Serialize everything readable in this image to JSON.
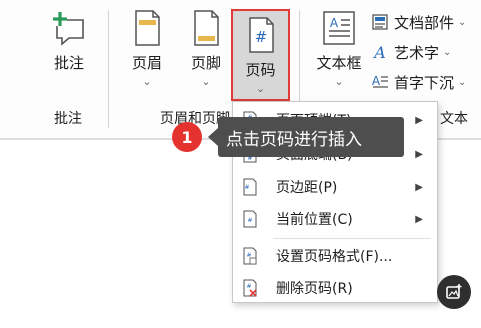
{
  "ribbon": {
    "buttons": {
      "pizhu": {
        "label": "批注",
        "icon": "add-comment-icon"
      },
      "yemei": {
        "label": "页眉",
        "icon": "header-icon"
      },
      "yejiao": {
        "label": "页脚",
        "icon": "footer-icon"
      },
      "yema": {
        "label": "页码",
        "icon": "page-number-icon"
      },
      "wenbenkuang": {
        "label": "文本框",
        "icon": "text-box-icon"
      }
    },
    "small_items": [
      {
        "label": "文档部件",
        "icon": "quick-parts-icon"
      },
      {
        "label": "艺术字",
        "icon": "wordart-icon"
      },
      {
        "label": "首字下沉",
        "icon": "drop-cap-icon"
      }
    ],
    "groups": {
      "comment": "批注",
      "header_footer": "页眉和页脚",
      "text": "文本"
    },
    "chevron": "⌄"
  },
  "page_number_menu": {
    "items": [
      {
        "label": "页面顶端(T)",
        "icon": "page-top-icon",
        "submenu": true
      },
      {
        "label": "页面底端(B)",
        "icon": "page-bottom-icon",
        "submenu": true
      },
      {
        "label": "页边距(P)",
        "icon": "page-margin-icon",
        "submenu": true
      },
      {
        "label": "当前位置(C)",
        "icon": "current-position-icon",
        "submenu": true
      },
      {
        "label": "设置页码格式(F)...",
        "icon": "format-page-number-icon",
        "submenu": false
      },
      {
        "label": "删除页码(R)",
        "icon": "remove-page-number-icon",
        "submenu": false
      }
    ],
    "submenu_arrow": "▶"
  },
  "callout": {
    "number": "1",
    "text": "点击页码进行插入"
  },
  "colors": {
    "highlight_border": "#e03b37",
    "badge": "#e4322e",
    "tooltip_bg": "#4e4e4e"
  }
}
